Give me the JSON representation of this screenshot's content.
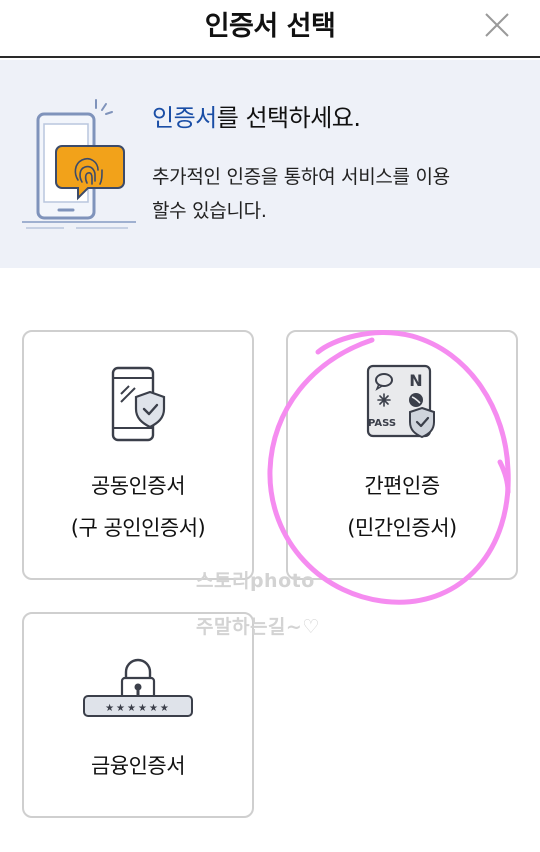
{
  "header": {
    "title": "인증서 선택"
  },
  "banner": {
    "headline_accent": "인증서",
    "headline_rest": "를 선택하세요.",
    "desc_line1": "추가적인 인증을 통하여 서비스를 이용",
    "desc_line2": "할수 있습니다."
  },
  "cards": {
    "joint": {
      "line1": "공동인증서",
      "line2": "(구 공인인증서)"
    },
    "simple": {
      "line1": "간편인증",
      "line2": "(민간인증서)",
      "pass_label": "PASS",
      "naver_label": "N"
    },
    "finance": {
      "line1": "금융인증서",
      "stars": "★★★★★★"
    }
  },
  "watermark": {
    "line1": "스토리photo",
    "line2": "주말하는길~♡"
  },
  "colors": {
    "accent": "#1a4ea6",
    "banner_bg": "#eef1f8",
    "highlight": "#f58cf0",
    "card_border": "#cfcfcf"
  }
}
